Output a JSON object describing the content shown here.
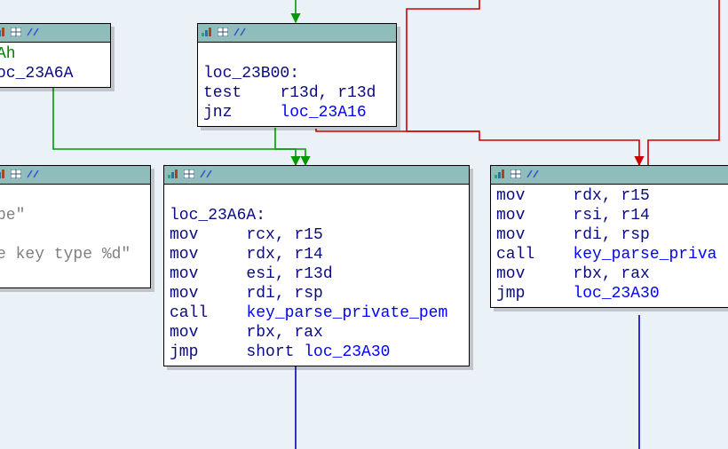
{
  "colors": {
    "background": "#eaf1f7",
    "node_bg": "#ffffff",
    "titlebar": "#8fbdbb",
    "edge_green": "#009900",
    "edge_red": "#cc0000",
    "edge_blue": "#0000cc",
    "label": "#0a0a80",
    "target": "#0000ff",
    "string": "#808080",
    "literal_green": "#008000"
  },
  "icons": {
    "chart": "chart-icon",
    "table": "table-icon",
    "xref": "xref-icon"
  },
  "nodes": {
    "n0": {
      "lines": [
        {
          "type": "literal",
          "text": "Ah"
        },
        {
          "type": "label_only",
          "label": "oc_23A6A"
        }
      ]
    },
    "n1": {
      "label": "loc_23B00:",
      "instructions": [
        {
          "mnemonic": "test",
          "ops": "r13d, r13d"
        },
        {
          "mnemonic": "jnz",
          "target": "loc_23A16"
        }
      ]
    },
    "n2": {
      "strings": [
        "pe\"",
        "e key type %d\""
      ]
    },
    "n3": {
      "label": "loc_23A6A:",
      "instructions": [
        {
          "mnemonic": "mov",
          "ops": "rcx, r15"
        },
        {
          "mnemonic": "mov",
          "ops": "rdx, r14"
        },
        {
          "mnemonic": "mov",
          "ops": "esi, r13d"
        },
        {
          "mnemonic": "mov",
          "ops": "rdi, rsp"
        },
        {
          "mnemonic": "call",
          "target": "key_parse_private_pem"
        },
        {
          "mnemonic": "mov",
          "ops": "rbx, rax"
        },
        {
          "mnemonic": "jmp",
          "ops_pfx": "short ",
          "target": "loc_23A30"
        }
      ]
    },
    "n4": {
      "instructions": [
        {
          "mnemonic": "mov",
          "ops": "rdx, r15"
        },
        {
          "mnemonic": "mov",
          "ops": "rsi, r14"
        },
        {
          "mnemonic": "mov",
          "ops": "rdi, rsp"
        },
        {
          "mnemonic": "call",
          "target": "key_parse_priva"
        },
        {
          "mnemonic": "mov",
          "ops": "rbx, rax"
        },
        {
          "mnemonic": "jmp",
          "target": "loc_23A30"
        }
      ]
    }
  }
}
